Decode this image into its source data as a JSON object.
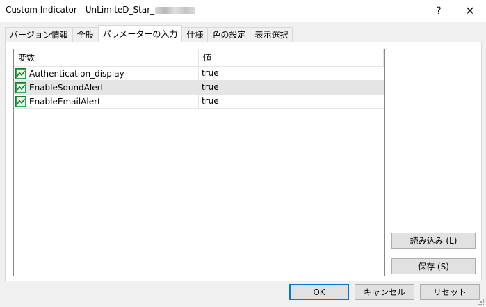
{
  "window": {
    "title": "Custom Indicator - UnLimiteD_Star_",
    "help_glyph": "?",
    "close_glyph": "✕"
  },
  "tabs": [
    {
      "label": "バージョン情報",
      "active": false
    },
    {
      "label": "全般",
      "active": false
    },
    {
      "label": "パラメーターの入力",
      "active": true
    },
    {
      "label": "仕様",
      "active": false
    },
    {
      "label": "色の設定",
      "active": false
    },
    {
      "label": "表示選択",
      "active": false
    }
  ],
  "table": {
    "columns": [
      "変数",
      "値"
    ],
    "rows": [
      {
        "name": "Authentication_display",
        "value": "true",
        "icon": "parameter-icon",
        "selected": false
      },
      {
        "name": "EnableSoundAlert",
        "value": "true",
        "icon": "parameter-icon",
        "selected": true
      },
      {
        "name": "EnableEmailAlert",
        "value": "true",
        "icon": "parameter-icon",
        "selected": false
      }
    ]
  },
  "side_buttons": {
    "load": "読み込み (L)",
    "save": "保存 (S)"
  },
  "footer_buttons": {
    "ok": "OK",
    "cancel": "キャンセル",
    "reset": "リセット"
  },
  "colors": {
    "icon_green": "#2fa64a",
    "accent_blue": "#0078d7"
  }
}
